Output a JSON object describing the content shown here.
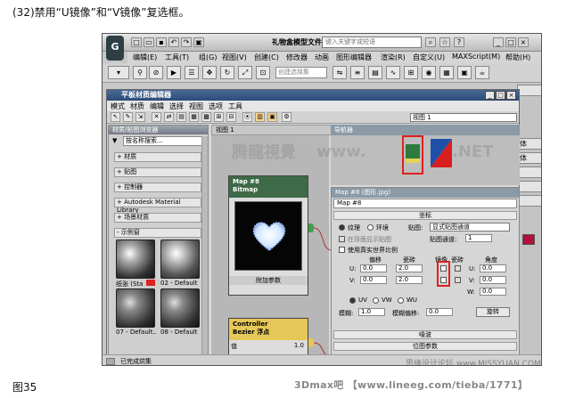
{
  "caption": "(32)禁用“U镜像”和“V镜像”复选框。",
  "figure_label": "图35",
  "credits": "3Dmax吧 【www.lineeg.com/tieba/1771】",
  "watermark_left": "腾龍視覺",
  "watermark_www": "www.",
  "watermark_net": ".NET",
  "watermark_site": "思缘设计论坛 www.MISSYUAN.COM",
  "max": {
    "logo": "G",
    "title": "礼物盒模型文件.max",
    "search_placeholder": "键入关键字或短语",
    "menu": [
      "编辑(E)",
      "工具(T)",
      "组(G)",
      "视图(V)",
      "创建(C)",
      "修改器",
      "动画",
      "图形编辑器",
      "渲染(R)",
      "自定义(U)",
      "MAXScript(M)",
      "帮助(H)"
    ],
    "selection_placeholder": "创建选择集",
    "right_panel": [
      "",
      "",
      "",
      "体",
      "体",
      "",
      "",
      "",
      ""
    ]
  },
  "sme": {
    "title": "平板材质编辑器",
    "menu": [
      "模式",
      "材质",
      "编辑",
      "选择",
      "视图",
      "选项",
      "工具"
    ],
    "browser_header": "材质/贴图浏览器",
    "search_placeholder": "按名称搜索...",
    "rollouts": [
      "+ 材质",
      "+ 贴图",
      "+ 控制器",
      "+ Autodesk Material Library",
      "+ 场景材质",
      "- 示例窗"
    ],
    "swatches": [
      "纸张 (Sta",
      "02 - Default",
      "07 - Default...",
      "08 - Default"
    ],
    "view_tab": "视图 1",
    "view_select": "视图 1",
    "node1": {
      "line1": "Map #8",
      "line2": "Bitmap",
      "footer": "附加参数"
    },
    "node2": {
      "line1": "Controller",
      "line2": "Bezier 浮点",
      "row_label": "值",
      "row_value": "1.0"
    },
    "nav_header": "导航器",
    "props_header": "Map #8 (图形.jpg)",
    "props_name": "Map #8",
    "sect_coords": "坐标",
    "radio_texture": "纹理",
    "radio_env": "环境",
    "map_label": "贴图:",
    "map_value": "显式贴图通道",
    "show_bg": "在背面显示贴图",
    "channel_label": "贴图通道:",
    "channel_value": "1",
    "real_world": "使用真实世界比例",
    "col_offset": "偏移",
    "col_tiling": "瓷砖",
    "col_mirror": "镜像",
    "col_tile": "瓷砖",
    "col_angle": "角度",
    "u_label": "U:",
    "v_label": "V:",
    "w_label": "W:",
    "u_offset": "0.0",
    "v_offset": "0.0",
    "u_tiling": "2.0",
    "v_tiling": "2.0",
    "u_angle": "0.0",
    "v_angle": "0.0",
    "w_angle": "0.0",
    "radio_uv": "UV",
    "radio_vw": "VW",
    "radio_wu": "WU",
    "blur_label": "模糊:",
    "blur_value": "1.0",
    "blur_offset_label": "模糊偏移:",
    "blur_offset_value": "0.0",
    "rotate_button": "旋转",
    "sect_noise": "噪波",
    "sect_bitmap": "位图参数",
    "status": "已完成烘集"
  },
  "colors": {
    "highlight": "#e02020",
    "title_blue": "#2c4a78",
    "node_green": "#3e6a48",
    "node_yellow": "#e6c85a"
  }
}
